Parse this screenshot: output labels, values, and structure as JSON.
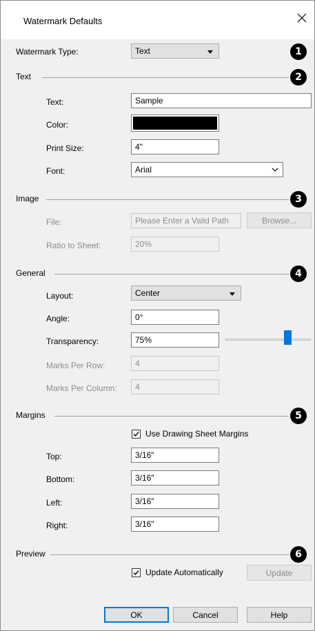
{
  "title": "Watermark Defaults",
  "watermark_type": {
    "label": "Watermark Type:",
    "value": "Text"
  },
  "sections": {
    "text": "Text",
    "image": "Image",
    "general": "General",
    "margins": "Margins",
    "preview": "Preview"
  },
  "callouts": [
    "1",
    "2",
    "3",
    "4",
    "5",
    "6"
  ],
  "text_section": {
    "text_label": "Text:",
    "text_value": "Sample",
    "color_label": "Color:",
    "color_value": "#000000",
    "print_size_label": "Print Size:",
    "print_size_value": "4\"",
    "font_label": "Font:",
    "font_value": "Arial"
  },
  "image_section": {
    "file_label": "File:",
    "file_placeholder": "Please Enter a Valid Path",
    "browse_label": "Browse...",
    "ratio_label": "Ratio to Sheet:",
    "ratio_value": "20%"
  },
  "general_section": {
    "layout_label": "Layout:",
    "layout_value": "Center",
    "angle_label": "Angle:",
    "angle_value": "0°",
    "transparency_label": "Transparency:",
    "transparency_value": "75%",
    "transparency_slider": 75,
    "marks_row_label": "Marks Per Row:",
    "marks_row_value": "4",
    "marks_col_label": "Marks Per Column:",
    "marks_col_value": "4"
  },
  "margins_section": {
    "use_sheet_margins_label": "Use Drawing Sheet Margins",
    "use_sheet_margins_checked": true,
    "top_label": "Top:",
    "top_value": "3/16\"",
    "bottom_label": "Bottom:",
    "bottom_value": "3/16\"",
    "left_label": "Left:",
    "left_value": "3/16\"",
    "right_label": "Right:",
    "right_value": "3/16\""
  },
  "preview_section": {
    "update_auto_label": "Update Automatically",
    "update_auto_checked": true,
    "update_label": "Update"
  },
  "buttons": {
    "ok": "OK",
    "cancel": "Cancel",
    "help": "Help"
  }
}
